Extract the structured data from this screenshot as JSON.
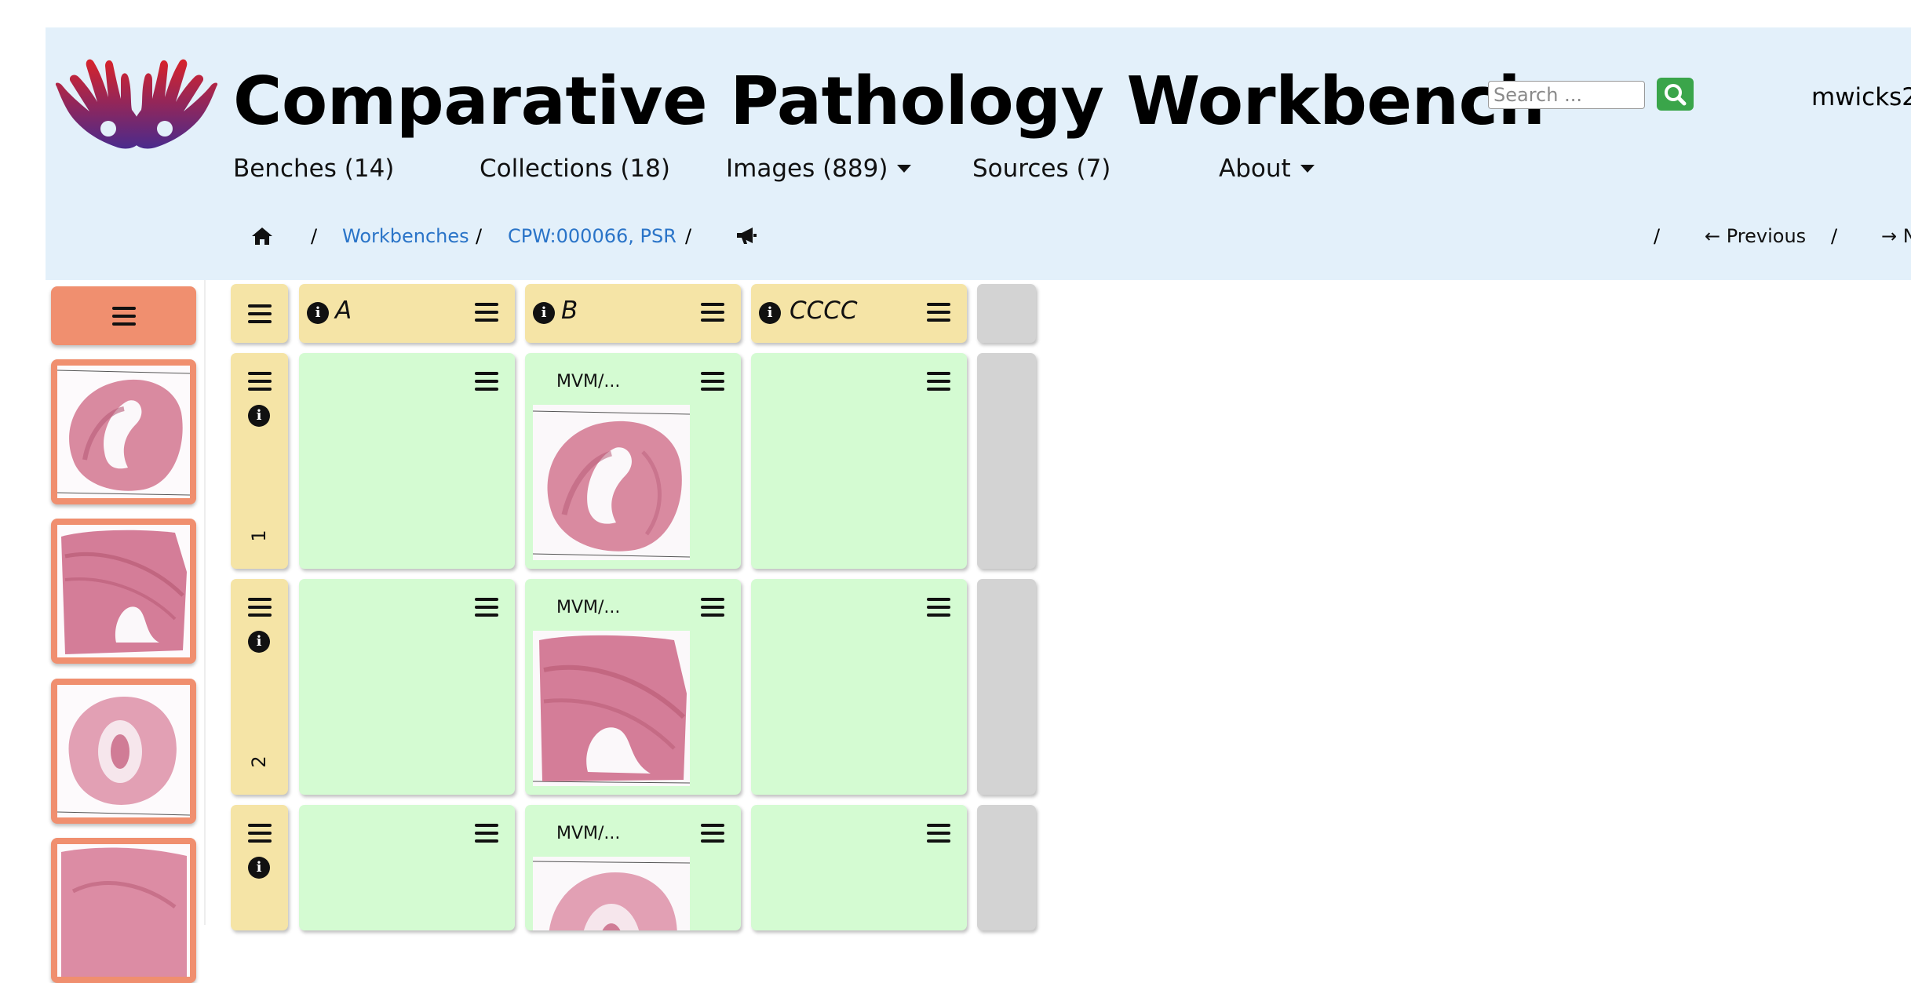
{
  "app": {
    "title": "Comparative Pathology Workbench",
    "username": "mwicks2"
  },
  "search": {
    "placeholder": "Search ..."
  },
  "nav": {
    "benches": "Benches (14)",
    "collections": "Collections (18)",
    "images": "Images (889)",
    "sources": "Sources (7)",
    "about": "About"
  },
  "breadcrumb": {
    "sep": "/",
    "workbenches": "Workbenches",
    "bench": "CPW:000066, PSR",
    "previous": "← Previous",
    "next": "→ N"
  },
  "grid": {
    "columns": [
      {
        "label": "A"
      },
      {
        "label": "B"
      },
      {
        "label": "CCCC"
      }
    ],
    "rows": [
      {
        "label": "1"
      },
      {
        "label": "2"
      },
      {
        "label": ""
      }
    ],
    "image_title": "MVM/..."
  },
  "colors": {
    "header_bg": "#e3f0fa",
    "sidebar_card": "#f08f6f",
    "header_cell": "#f5e4a6",
    "content_cell": "#d4fbd2",
    "empty_cell": "#d3d3d3",
    "search_button": "#3aa54a",
    "link": "#2a74c8"
  },
  "icons": [
    "logo-hands-icon",
    "search-icon",
    "home-icon",
    "bullhorn-icon",
    "menu-icon",
    "info-icon",
    "caret-down-icon"
  ]
}
